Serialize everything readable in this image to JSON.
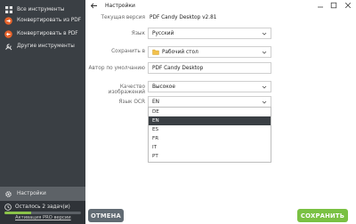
{
  "window": {
    "title": "Настройки"
  },
  "sidebar": {
    "items": [
      {
        "label": "Все инструменты",
        "icon": "grid-icon"
      },
      {
        "label": "Конвертировать из PDF",
        "icon": "arrow-out-icon"
      },
      {
        "label": "Конвертировать в PDF",
        "icon": "arrow-in-icon"
      },
      {
        "label": "Другие инструменты",
        "icon": "tools-icon"
      }
    ],
    "settings_label": "Настройки",
    "status": {
      "tasks_label": "Осталось 2 задач(и)",
      "pro_link": "Активация PRO версии",
      "progress": 0.35
    }
  },
  "form": {
    "version_label": "Текущая версия",
    "version_value": "PDF Candy Desktop    v2.81",
    "language_label": "Язык",
    "language_value": "Русский",
    "save_to_label": "Сохранить в",
    "save_to_value": "Рабочий стол",
    "author_label": "Автор по умолчанию",
    "author_value": "PDF Candy Desktop",
    "quality_label": "Качество изображений",
    "quality_value": "Высокое",
    "ocr_label": "Язык OCR",
    "ocr_value": "EN",
    "ocr_options": [
      "DE",
      "EN",
      "ES",
      "FR",
      "IT",
      "PT"
    ],
    "ocr_selected": "EN"
  },
  "buttons": {
    "cancel": "ОТМЕНА",
    "save": "СОХРАНИТЬ"
  },
  "colors": {
    "sidebar_bg": "#3a3f44",
    "accent_green": "#7ac143",
    "icon_orange": "#e8642c"
  }
}
